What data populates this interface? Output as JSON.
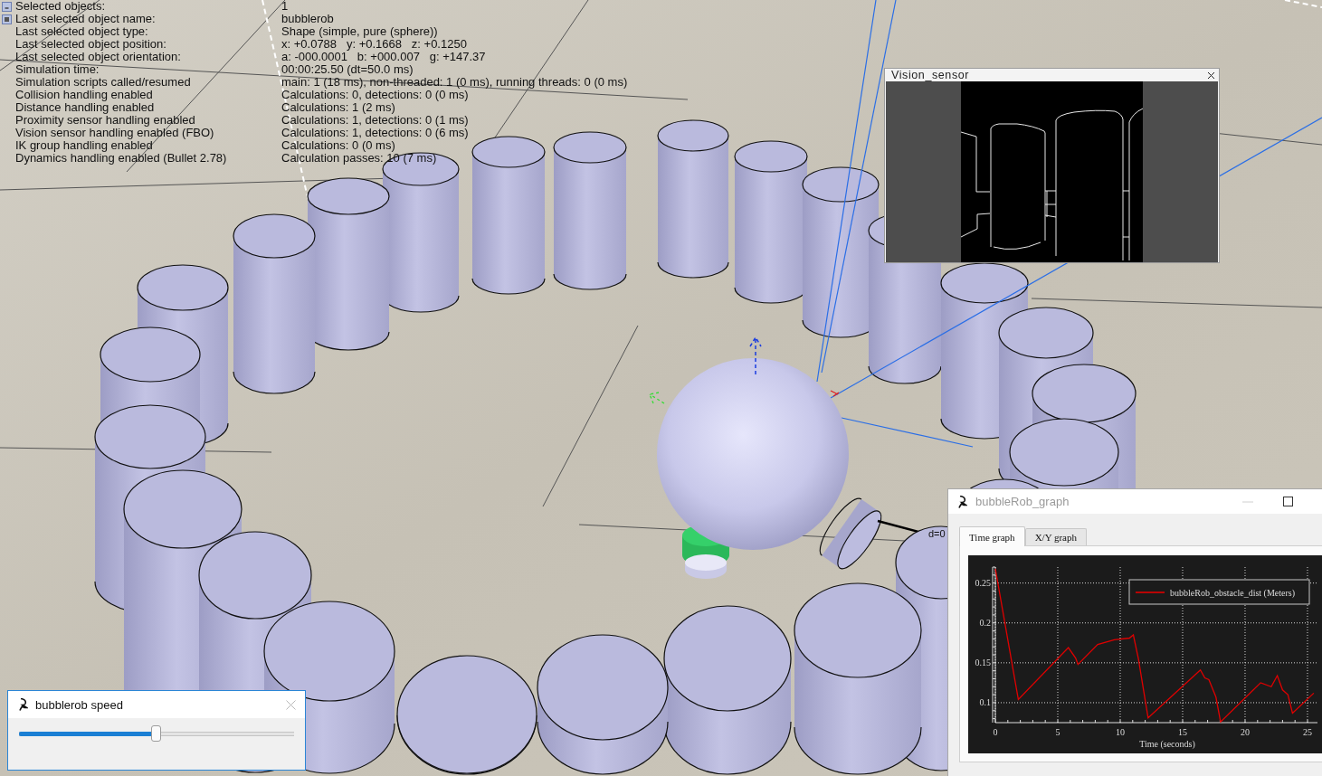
{
  "info_panel": {
    "rows": [
      {
        "label": "Selected objects:",
        "value": "1"
      },
      {
        "label": "Last selected object name:",
        "value": "bubblerob"
      },
      {
        "label": "Last selected object type:",
        "value": "Shape (simple, pure (sphere))"
      },
      {
        "label": "Last selected object position:",
        "value": "x: +0.0788   y: +0.1668   z: +0.1250"
      },
      {
        "label": "Last selected object orientation:",
        "value": "a: -000.0001   b: +000.007   g: +147.37"
      },
      {
        "label": "Simulation time:",
        "value": "00:00:25.50 (dt=50.0 ms)"
      },
      {
        "label": "Simulation scripts called/resumed",
        "value": "main: 1 (18 ms), non-threaded: 1 (0 ms), running threads: 0 (0 ms)"
      },
      {
        "label": "Collision handling enabled",
        "value": "Calculations: 0, detections: 0 (0 ms)"
      },
      {
        "label": "Distance handling enabled",
        "value": "Calculations: 1 (2 ms)"
      },
      {
        "label": "Proximity sensor handling enabled",
        "value": "Calculations: 1, detections: 0 (1 ms)"
      },
      {
        "label": "Vision sensor handling enabled (FBO)",
        "value": "Calculations: 1, detections: 0 (6 ms)"
      },
      {
        "label": "IK group handling enabled",
        "value": "Calculations: 0 (0 ms)"
      },
      {
        "label": "Dynamics handling enabled (Bullet 2.78)",
        "value": "Calculation passes: 10 (7 ms)"
      }
    ]
  },
  "scene": {
    "distance_label": "d=0"
  },
  "vision_sensor_window": {
    "title": "Vision_sensor"
  },
  "graph_window": {
    "title": "bubbleRob_graph",
    "tabs": [
      {
        "label": "Time graph",
        "selected": true
      },
      {
        "label": "X/Y graph",
        "selected": false
      }
    ],
    "chart_data": {
      "type": "line",
      "xlabel": "Time (seconds)",
      "x": [
        0,
        1.84,
        5.85,
        6.43,
        6.62,
        8.2,
        9.53,
        10.74,
        11.05,
        11.46,
        12.23,
        16.42,
        16.78,
        17.1,
        17.67,
        18.04,
        21.25,
        22.1,
        22.58,
        23.0,
        23.43,
        23.8,
        25.5
      ],
      "series": [
        {
          "name": "bubbleRob_obstacle_dist (Meters)",
          "color": "#e00000",
          "values": [
            0.268,
            0.104,
            0.169,
            0.156,
            0.148,
            0.173,
            0.179,
            0.181,
            0.185,
            0.155,
            0.081,
            0.141,
            0.131,
            0.129,
            0.107,
            0.076,
            0.125,
            0.12,
            0.134,
            0.116,
            0.11,
            0.087,
            0.112
          ]
        }
      ],
      "xlim": [
        0,
        25.8
      ],
      "ylim": [
        0.075,
        0.27
      ],
      "xticks": [
        0,
        5,
        10,
        15,
        20,
        25
      ],
      "yticks": [
        0.1,
        0.15,
        0.2,
        0.25
      ],
      "grid": true
    }
  },
  "slider_window": {
    "title": "bubblerob speed",
    "level": 0.5
  }
}
